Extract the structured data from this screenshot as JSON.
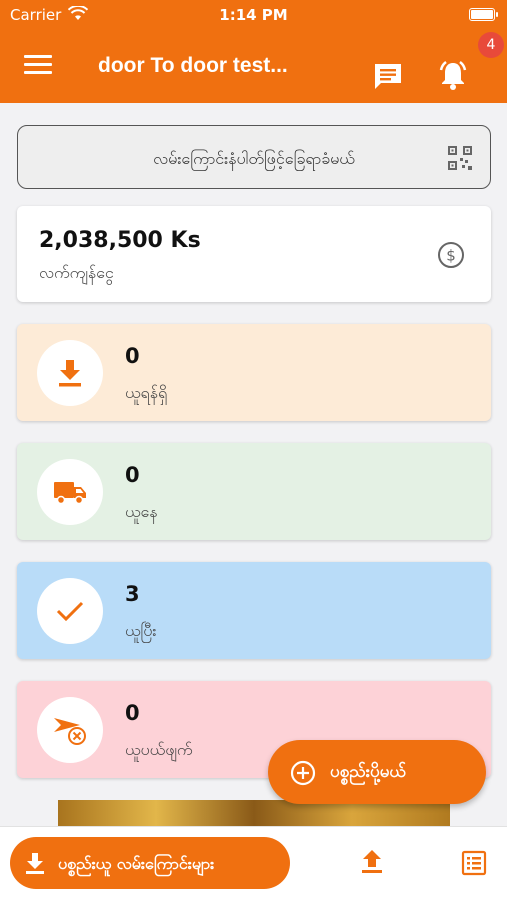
{
  "status_bar": {
    "carrier": "Carrier",
    "time": "1:14 PM"
  },
  "header": {
    "title": "door To door test...",
    "notification_count": "4"
  },
  "scan": {
    "label": "လမ်းကြောင်းနံပါတ်ဖြင့်ခြေရာခံမယ်"
  },
  "balance": {
    "amount": "2,038,500 Ks",
    "label": "လက်ကျန်ငွေ"
  },
  "stats": [
    {
      "count": "0",
      "label": "ယူရန်ရှိ",
      "icon": "download-icon",
      "bg": "#fdebd7"
    },
    {
      "count": "0",
      "label": "ယူနေ",
      "icon": "truck-icon",
      "bg": "#e4f1e4"
    },
    {
      "count": "3",
      "label": "ယူပြီး",
      "icon": "check-icon",
      "bg": "#b9dcf8"
    },
    {
      "count": "0",
      "label": "ယူပယ်ဖျက်",
      "icon": "cancel-delivery-icon",
      "bg": "#fdd2d7"
    }
  ],
  "fab": {
    "label": "ပစ္စည်းပို့မယ်"
  },
  "bottom": {
    "pickup_routes_label": "ပစ္စည်းယူ လမ်းကြောင်းများ"
  },
  "colors": {
    "accent": "#f07010",
    "badge": "#e84a3a"
  }
}
